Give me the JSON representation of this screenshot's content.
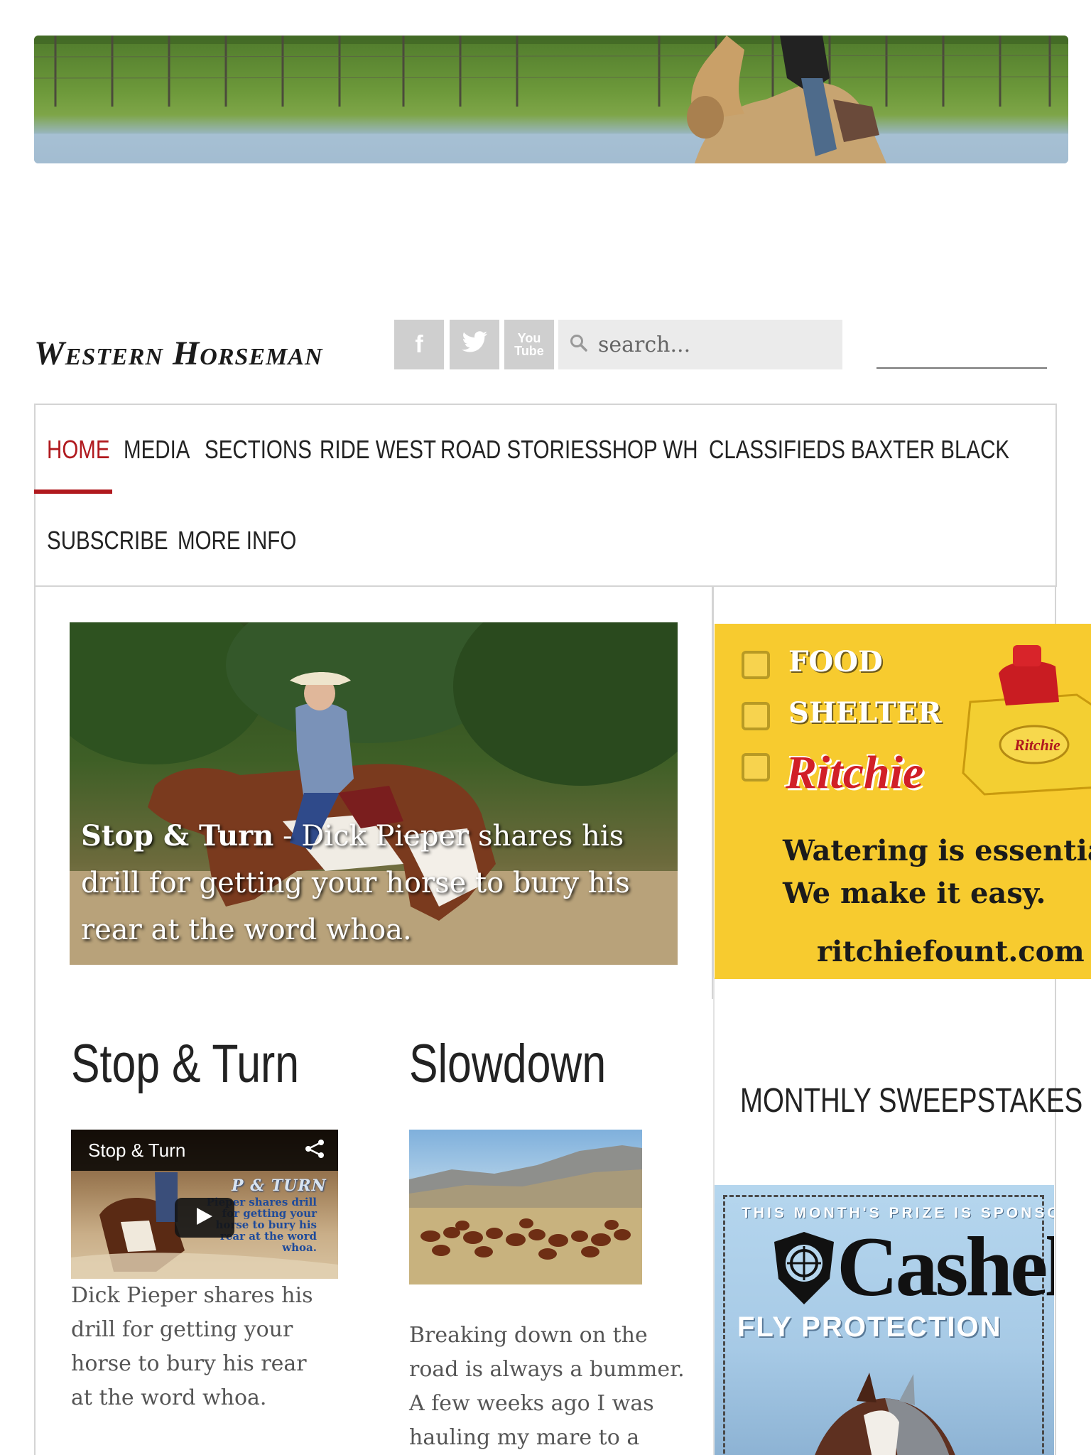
{
  "site": {
    "logo_text": "Western Horseman",
    "search_placeholder": "search...",
    "social": {
      "facebook": "f",
      "twitter": "t",
      "youtube_top": "You",
      "youtube_bottom": "Tube"
    }
  },
  "nav": {
    "items": [
      "HOME",
      "MEDIA",
      "SECTIONS",
      "RIDE WEST",
      "ROAD STORIES",
      "SHOP WH",
      "CLASSIFIEDS",
      "BAXTER BLACK",
      "SUBSCRIBE",
      "MORE INFO"
    ],
    "active": "HOME",
    "accent_color": "#b0191e"
  },
  "feature": {
    "caption_bold": "Stop & Turn",
    "caption_rest": " - Dick Pieper shares his drill for getting your horse to bury his rear at the word whoa."
  },
  "articles": [
    {
      "title": "Stop & Turn",
      "video_title": "Stop & Turn",
      "video_overlay_title": "P & TURN",
      "video_overlay_text": "Pieper shares drill for getting your horse to bury his rear at the word whoa.",
      "excerpt": "Dick Pieper shares his drill for getting your horse to bury his rear at the word whoa."
    },
    {
      "title": "Slowdown",
      "excerpt": "Breaking down on the road is always a bummer. A few weeks ago I was hauling my mare to a"
    }
  ],
  "sidebar": {
    "ad_ritchie": {
      "items": [
        "FOOD",
        "SHELTER"
      ],
      "brand": "Ritchie",
      "tagline_1": "Watering is essential.",
      "tagline_2": "We make it easy.",
      "url": "ritchiefount.com",
      "background": "#f7cb2f"
    },
    "sweepstakes_title": "MONTHLY SWEEPSTAKES",
    "ad_cashel": {
      "sponsor_line": "THIS MONTH'S PRIZE IS SPONSORED BY:",
      "brand": "Cashel",
      "product": "FLY PROTECTION"
    }
  }
}
